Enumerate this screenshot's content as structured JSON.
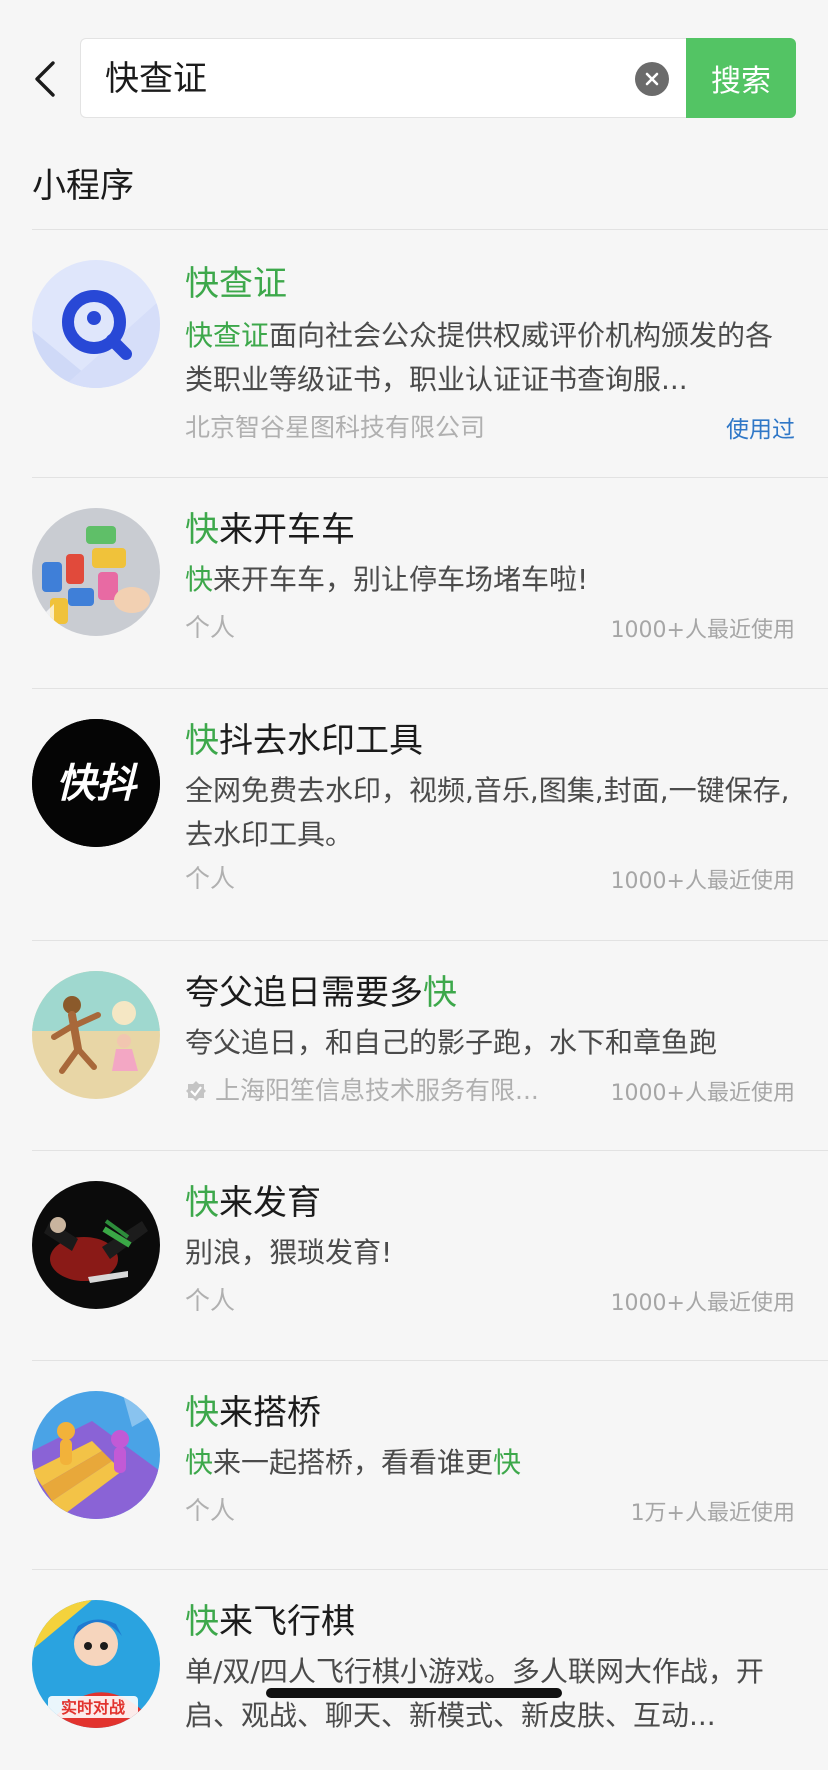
{
  "search": {
    "query": "快查证",
    "button_label": "搜索"
  },
  "section": {
    "title": "小程序"
  },
  "results": [
    {
      "title_parts": [
        {
          "t": "快查证",
          "h": true
        }
      ],
      "desc_parts": [
        {
          "t": "快查证",
          "h": true
        },
        {
          "t": "面向社会公众提供权威评价机构颁发的各类职业等级证书，职业认证证书查询服...",
          "h": false
        }
      ],
      "owner": "北京智谷星图科技有限公司",
      "usage": "使用过",
      "icon": "magnifier-logo-icon"
    },
    {
      "title_parts": [
        {
          "t": "快",
          "h": true
        },
        {
          "t": "来开车车",
          "h": false
        }
      ],
      "desc_parts": [
        {
          "t": "快",
          "h": true
        },
        {
          "t": "来开车车，别让停车场堵车啦!",
          "h": false
        }
      ],
      "owner": "个人",
      "usage": "1000+人最近使用",
      "icon": "parking-lot-game-icon"
    },
    {
      "title_parts": [
        {
          "t": "快",
          "h": true
        },
        {
          "t": "抖去水印工具",
          "h": false
        }
      ],
      "desc_parts": [
        {
          "t": "全网免费去水印，视频,音乐,图集,封面,一键保存,去水印工具。",
          "h": false
        }
      ],
      "owner": "个人",
      "usage": "1000+人最近使用",
      "icon": "kuaidou-logo-icon",
      "icon_text": "快抖"
    },
    {
      "title_parts": [
        {
          "t": "夸父追日需要多",
          "h": false
        },
        {
          "t": "快",
          "h": true
        }
      ],
      "desc_parts": [
        {
          "t": "夸父追日，和自己的影子跑，水下和章鱼跑",
          "h": false
        }
      ],
      "owner": "上海阳笙信息技术服务有限...",
      "owner_verified": true,
      "usage": "1000+人最近使用",
      "icon": "running-figure-icon"
    },
    {
      "title_parts": [
        {
          "t": "快",
          "h": true
        },
        {
          "t": "来发育",
          "h": false
        }
      ],
      "desc_parts": [
        {
          "t": "别浪，猥琐发育!",
          "h": false
        }
      ],
      "owner": "个人",
      "usage": "1000+人最近使用",
      "icon": "battle-game-icon"
    },
    {
      "title_parts": [
        {
          "t": "快",
          "h": true
        },
        {
          "t": "来搭桥",
          "h": false
        }
      ],
      "desc_parts": [
        {
          "t": "快",
          "h": true
        },
        {
          "t": "来一起搭桥，看看谁更",
          "h": false
        },
        {
          "t": "快",
          "h": true
        }
      ],
      "owner": "个人",
      "usage": "1万+人最近使用",
      "icon": "bridge-runner-icon"
    },
    {
      "title_parts": [
        {
          "t": "快",
          "h": true
        },
        {
          "t": "来飞行棋",
          "h": false
        }
      ],
      "desc_parts": [
        {
          "t": "单/双/四人飞行棋小游戏。多人联网大作战，开启、观战、聊天、新模式、新皮肤、互动...",
          "h": false
        }
      ],
      "owner": "",
      "usage": "",
      "icon": "ludo-game-icon",
      "icon_text": "实时对战"
    }
  ],
  "colors": {
    "accent_green": "#53c464",
    "highlight_green": "#3da84b",
    "used_blue": "#2f77c7"
  }
}
